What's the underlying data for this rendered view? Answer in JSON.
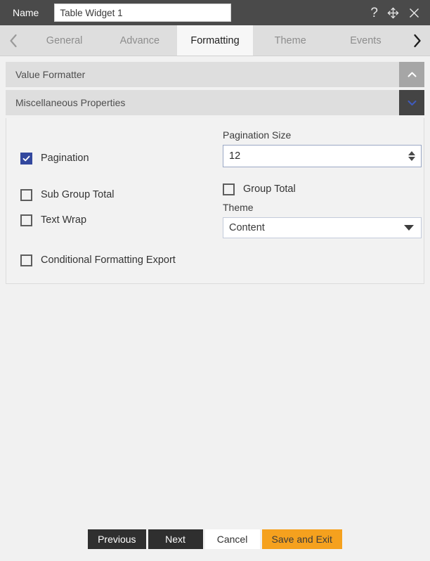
{
  "titlebar": {
    "name_label": "Name",
    "name_value": "Table Widget 1",
    "name_placeholder": "Table Widget 1",
    "help_icon": "question-mark-icon",
    "move_icon": "move-icon",
    "close_icon": "close-icon",
    "background": "#4a4a4a"
  },
  "tabbar": {
    "prev_icon": "chevron-left-icon",
    "next_icon": "chevron-right-icon",
    "tabs": [
      {
        "label": "General",
        "active": false
      },
      {
        "label": "Advance",
        "active": false
      },
      {
        "label": "Formatting",
        "active": true
      },
      {
        "label": "Theme",
        "active": false
      },
      {
        "label": "Events",
        "active": false
      }
    ]
  },
  "sections": {
    "value_formatter": {
      "title": "Value Formatter",
      "toggle_icon": "chevron-up-icon",
      "expanded": false
    },
    "misc_properties": {
      "title": "Miscellaneous Properties",
      "toggle_icon": "chevron-down-icon",
      "expanded": true
    }
  },
  "form": {
    "pagination": {
      "label": "Pagination",
      "checked": true
    },
    "sub_group_total": {
      "label": "Sub Group Total",
      "checked": false
    },
    "text_wrap": {
      "label": "Text Wrap",
      "checked": false
    },
    "conditional_formatting_export": {
      "label": "Conditional Formatting Export",
      "checked": false
    },
    "group_total": {
      "label": "Group Total",
      "checked": false
    },
    "pagination_size": {
      "label": "Pagination Size",
      "value": "12",
      "placeholder": "12"
    },
    "theme": {
      "label": "Theme",
      "value": "Content",
      "caret_icon": "caret-down-icon",
      "options": [
        "Content"
      ]
    }
  },
  "footer": {
    "previous_label": "Previous",
    "next_label": "Next",
    "cancel_label": "Cancel",
    "save_label": "Save and Exit",
    "accent_color": "#f5a11e"
  }
}
